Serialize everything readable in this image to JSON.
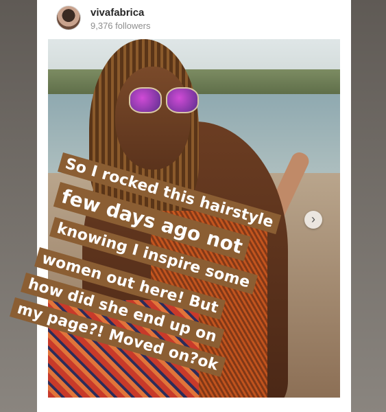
{
  "profile": {
    "username": "vivafabrica",
    "followers": "9,376 followers"
  },
  "story_text": {
    "line1": "So I rocked this hairstyle",
    "line2": "few days ago not",
    "line3": "knowing I inspire some",
    "line4": "women out here! But",
    "line5": "how did she end up on",
    "line6": "my page?! Moved on?ok"
  },
  "icons": {
    "next": "chevron-right-icon"
  },
  "colors": {
    "story_background": "#8b5e33",
    "story_text": "#ffffff"
  }
}
